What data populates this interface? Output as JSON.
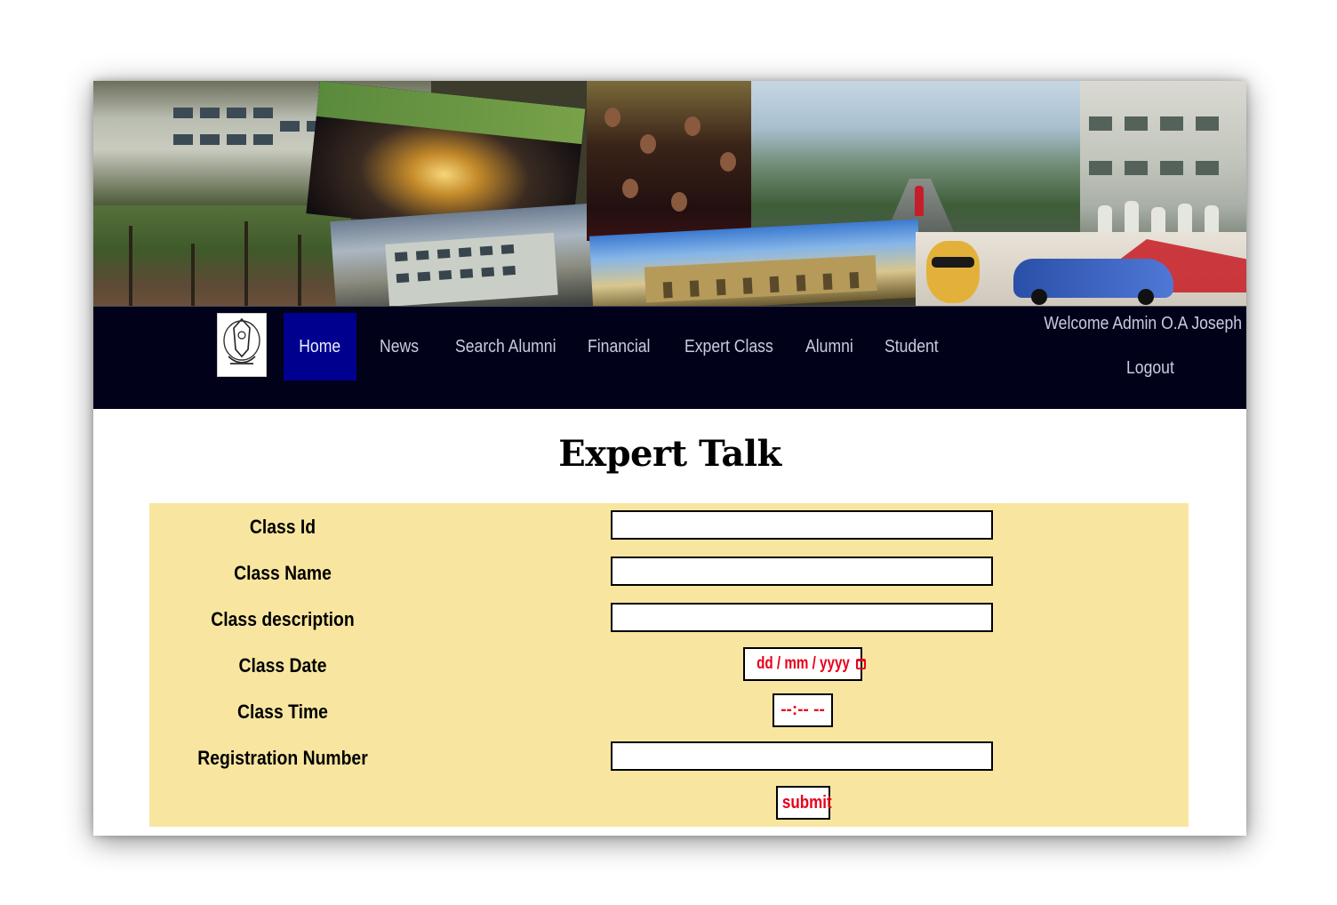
{
  "nav": {
    "items": [
      {
        "label": "Home",
        "active": true
      },
      {
        "label": "News"
      },
      {
        "label": "Search Alumni"
      },
      {
        "label": "Financial"
      },
      {
        "label": "Expert Class"
      },
      {
        "label": "Alumni"
      },
      {
        "label": "Student"
      }
    ],
    "welcome": "Welcome Admin O.A Joseph",
    "logout": "Logout"
  },
  "page": {
    "title": "Expert Talk"
  },
  "form": {
    "fields": [
      {
        "label": "Class Id",
        "value": ""
      },
      {
        "label": "Class Name",
        "value": ""
      },
      {
        "label": "Class description",
        "value": ""
      },
      {
        "label": "Class Date",
        "placeholder": "dd / mm / yyyy"
      },
      {
        "label": "Class Time",
        "placeholder": "--:-- --"
      },
      {
        "label": "Registration Number",
        "value": ""
      }
    ],
    "submit_label": "submit"
  },
  "colors": {
    "navbar_bg": "#01011a",
    "active_nav_bg": "#00008e",
    "form_bg": "#f8e6a0",
    "input_text": "#e8001c"
  }
}
